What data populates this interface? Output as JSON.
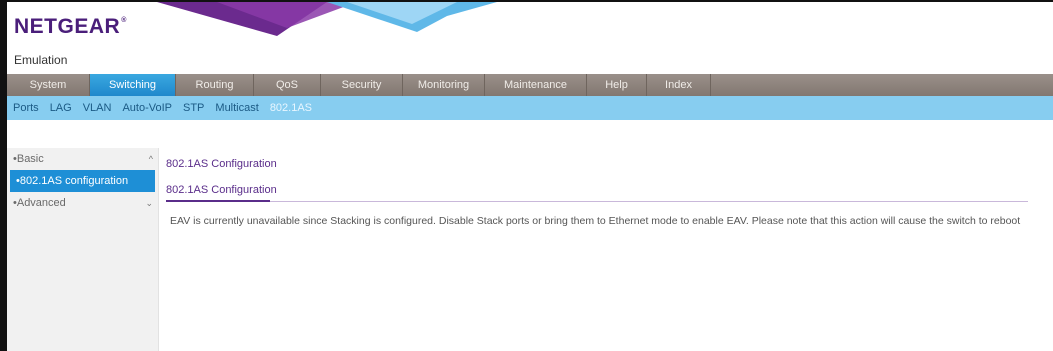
{
  "brand": {
    "logo": "NETGEAR",
    "trademark": "®",
    "mode_label": "Emulation"
  },
  "main_nav": {
    "tabs": [
      {
        "label": "System",
        "active": false
      },
      {
        "label": "Switching",
        "active": true
      },
      {
        "label": "Routing",
        "active": false
      },
      {
        "label": "QoS",
        "active": false
      },
      {
        "label": "Security",
        "active": false
      },
      {
        "label": "Monitoring",
        "active": false
      },
      {
        "label": "Maintenance",
        "active": false
      },
      {
        "label": "Help",
        "active": false
      },
      {
        "label": "Index",
        "active": false
      }
    ]
  },
  "sub_nav": {
    "items": [
      {
        "label": "Ports",
        "active": false
      },
      {
        "label": "LAG",
        "active": false
      },
      {
        "label": "VLAN",
        "active": false
      },
      {
        "label": "Auto-VoIP",
        "active": false
      },
      {
        "label": "STP",
        "active": false
      },
      {
        "label": "Multicast",
        "active": false
      },
      {
        "label": "802.1AS",
        "active": true
      }
    ]
  },
  "sidebar": {
    "basic": {
      "label": "•Basic",
      "arrow": "^"
    },
    "selected_item": {
      "label": "•802.1AS configuration"
    },
    "advanced": {
      "label": "•Advanced",
      "arrow": "⌄"
    }
  },
  "content": {
    "breadcrumb": "802.1AS Configuration",
    "section_title": "802.1AS Configuration",
    "notice": "EAV is currently unavailable since Stacking is configured. Disable Stack ports or bring them to Ethernet mode to enable EAV. Please note that this action will cause the switch to reboot"
  },
  "colors": {
    "brand_purple": "#4a1e7a",
    "active_tab_blue": "#1f88cc",
    "subnav_blue": "#87cdf0",
    "inactive_tab_gray": "#8a7f77"
  }
}
